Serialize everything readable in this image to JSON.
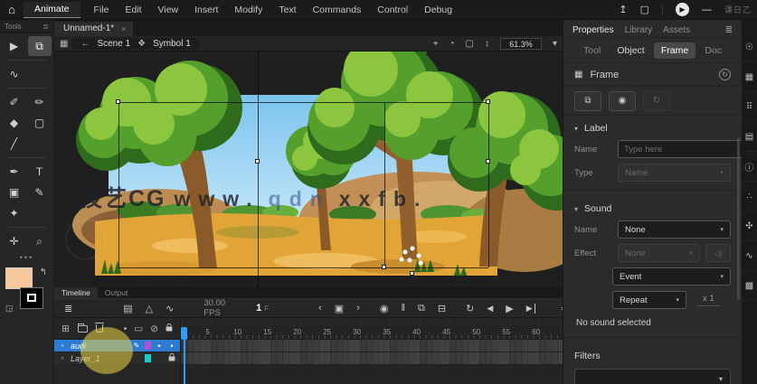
{
  "menubar": {
    "logo_glyph": "⌂",
    "app_label": "Animate",
    "items": [
      "File",
      "Edit",
      "View",
      "Insert",
      "Modify",
      "Text",
      "Commands",
      "Control",
      "Debug"
    ],
    "titlebar": {
      "share_icon": "↥",
      "frame_icon": "▢",
      "play_icon": "▶",
      "minimize": "—",
      "overlay_text": "课日乙"
    }
  },
  "document": {
    "tab": "Unnamed-1*",
    "close": "×"
  },
  "edit_bar": {
    "clip_icon": "▦",
    "back_icon": "←",
    "scene": "Scene 1",
    "symbol_icon": "❖",
    "symbol": "Symbol 1",
    "center_icon": "⌖",
    "orbit_icon": "◔",
    "clip_content_icon": "▢",
    "spin_icon": "↕",
    "zoom_value": "61.3%",
    "chevron": "▾"
  },
  "tools": {
    "title": "Tools",
    "menu_icon": "≣",
    "more": "•••",
    "fill_color": "#f6c79c",
    "stroke_color": "#000000",
    "swap_icon": "↰",
    "default_colors_icon": "◲",
    "groups": [
      [
        {
          "name": "selection-tool",
          "glyph": "▶"
        },
        {
          "name": "subselection-tool",
          "glyph": "⧉",
          "active": true
        }
      ],
      [
        {
          "name": "lasso-tool",
          "glyph": "∿"
        }
      ],
      [
        {
          "name": "fluid-brush-tool",
          "glyph": "✐"
        },
        {
          "name": "classic-brush-tool",
          "glyph": "✏"
        },
        {
          "name": "shape-tool",
          "glyph": "◆"
        },
        {
          "name": "rectangle-tool",
          "glyph": "▢"
        },
        {
          "name": "line-tool",
          "glyph": "╱"
        }
      ],
      [
        {
          "name": "pen-tool",
          "glyph": "✒"
        },
        {
          "name": "text-tool",
          "glyph": "T"
        },
        {
          "name": "paint-bucket-tool",
          "glyph": "▣"
        },
        {
          "name": "pencil-tool",
          "glyph": "✎"
        },
        {
          "name": "asset-warp-tool",
          "glyph": "✦"
        }
      ],
      [
        {
          "name": "hand-tool",
          "glyph": "✛"
        },
        {
          "name": "zoom-tool",
          "glyph": "⌕"
        }
      ]
    ]
  },
  "canvas": {
    "watermark_cn": "技艺CG",
    "watermark_latin_1": "www.",
    "watermark_latin_2": "qdn",
    "watermark_latin_3": "xxfb."
  },
  "properties": {
    "panel_tabs": [
      {
        "label": "Properties",
        "active": true
      },
      {
        "label": "Library"
      },
      {
        "label": "Assets"
      }
    ],
    "menu_icon": "≣",
    "subtabs": [
      {
        "label": "Tool"
      },
      {
        "label": "Object",
        "obj": true
      },
      {
        "label": "Frame",
        "active": true
      },
      {
        "label": "Doc"
      }
    ],
    "frame": {
      "icon": "▦",
      "title": "Frame",
      "help_icon": "↻"
    },
    "quick_buttons": [
      {
        "name": "stack-button",
        "glyph": "⧉"
      },
      {
        "name": "visibility-button",
        "glyph": "◉"
      },
      {
        "name": "loop-button",
        "glyph": "↻",
        "disabled": true
      }
    ],
    "label_section": {
      "title": "Label",
      "chevron": "▾",
      "name_label": "Name",
      "name_placeholder": "Type here",
      "type_label": "Type",
      "type_value": "Name"
    },
    "sound_section": {
      "title": "Sound",
      "chevron": "▾",
      "name_label": "Name",
      "name_value": "None",
      "effect_label": "Effect",
      "effect_value": "None",
      "speaker_icon": "◁)",
      "sync_value": "Event",
      "repeat_value": "Repeat",
      "repeat_count": "x 1",
      "status": "No sound selected"
    },
    "filters_section": {
      "title": "Filters"
    },
    "select_chevron": "▾"
  },
  "timeline": {
    "tabs": [
      {
        "label": "Timeline",
        "active": true
      },
      {
        "label": "Output"
      }
    ],
    "toolbar": {
      "layers_icon": "≣",
      "film_icon": "▤",
      "onion_all_icon": "△",
      "graph_icon": "∿",
      "fps": "30.00 FPS",
      "frame": "1",
      "frame_unit": "F",
      "prev_icon": "‹",
      "keyframe_icon": "▣",
      "next_icon": "›",
      "autokey_icon": "◉",
      "pause_icon": "‖",
      "insert_frame_icon": "⧉",
      "remove_frame_icon": "⊟",
      "loop_icon": "↻",
      "step_back_icon": "◀",
      "play_icon": "▶",
      "step_fwd_icon": "▶",
      "onion_marker_icon": "≙",
      "zoom_fit_icon": "▲"
    },
    "layers_header": {
      "add_icon": "⊞",
      "dot_icon": "•",
      "outline_icon": "▭",
      "hide_icon": "⊘"
    },
    "layers": [
      {
        "name": "audi",
        "selected": true,
        "outline_color": "#b44fd8",
        "edit_icon": "✎",
        "vis": "•",
        "lock_dot": "•"
      },
      {
        "name": "Layer_1",
        "outline_color": "#18cfcf",
        "locked": true
      }
    ],
    "ruler_numbers": [
      5,
      10,
      15,
      20,
      25,
      30,
      35,
      40,
      45,
      50,
      55,
      60
    ],
    "frame_width": 6.6
  },
  "dock": [
    {
      "name": "fluid-brush-panel-icon",
      "glyph": "☉"
    },
    {
      "name": "swatches-panel-icon",
      "glyph": "▦"
    },
    {
      "name": "color-panel-icon",
      "glyph": "⠿"
    },
    {
      "name": "align-panel-icon",
      "glyph": "▤"
    },
    {
      "name": "info-panel-icon",
      "glyph": "ⓘ"
    },
    {
      "name": "particles-panel-icon",
      "glyph": "∴"
    },
    {
      "name": "brush-library-panel-icon",
      "glyph": "✣"
    },
    {
      "name": "history-panel-icon",
      "glyph": "∿"
    },
    {
      "name": "pattern-panel-icon",
      "glyph": "▩"
    }
  ]
}
